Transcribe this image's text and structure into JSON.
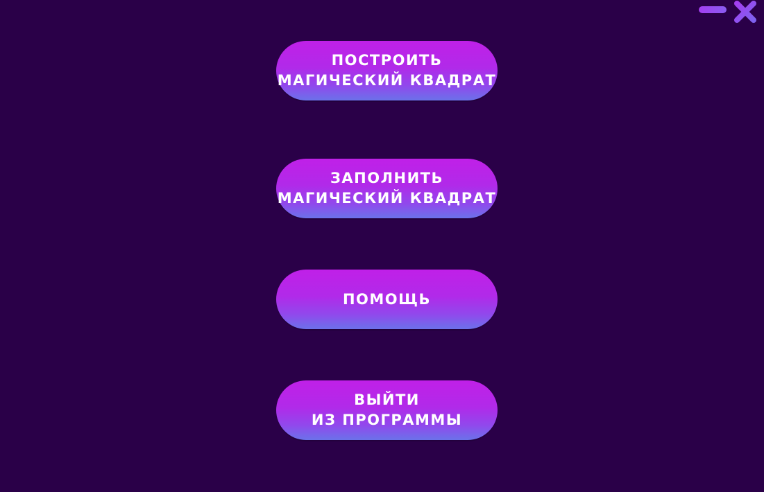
{
  "window_controls": {
    "minimize_icon": "minimize-icon",
    "close_icon": "close-icon",
    "accent_color": "#9b45f0"
  },
  "menu": {
    "build": {
      "line1": "ПОСТРОИТЬ",
      "line2": "МАГИЧЕСКИЙ КВАДРАТ"
    },
    "fill": {
      "line1": "ЗАПОЛНИТЬ",
      "line2": "МАГИЧЕСКИЙ КВАДРАТ"
    },
    "help": {
      "line1": "ПОМОЩЬ"
    },
    "exit": {
      "line1": "ВЫЙТИ",
      "line2": "ИЗ ПРОГРАММЫ"
    }
  },
  "colors": {
    "background": "#2a0048",
    "button_top": "#c020e8",
    "button_bottom": "#6b72ea",
    "text": "#ffffff"
  }
}
